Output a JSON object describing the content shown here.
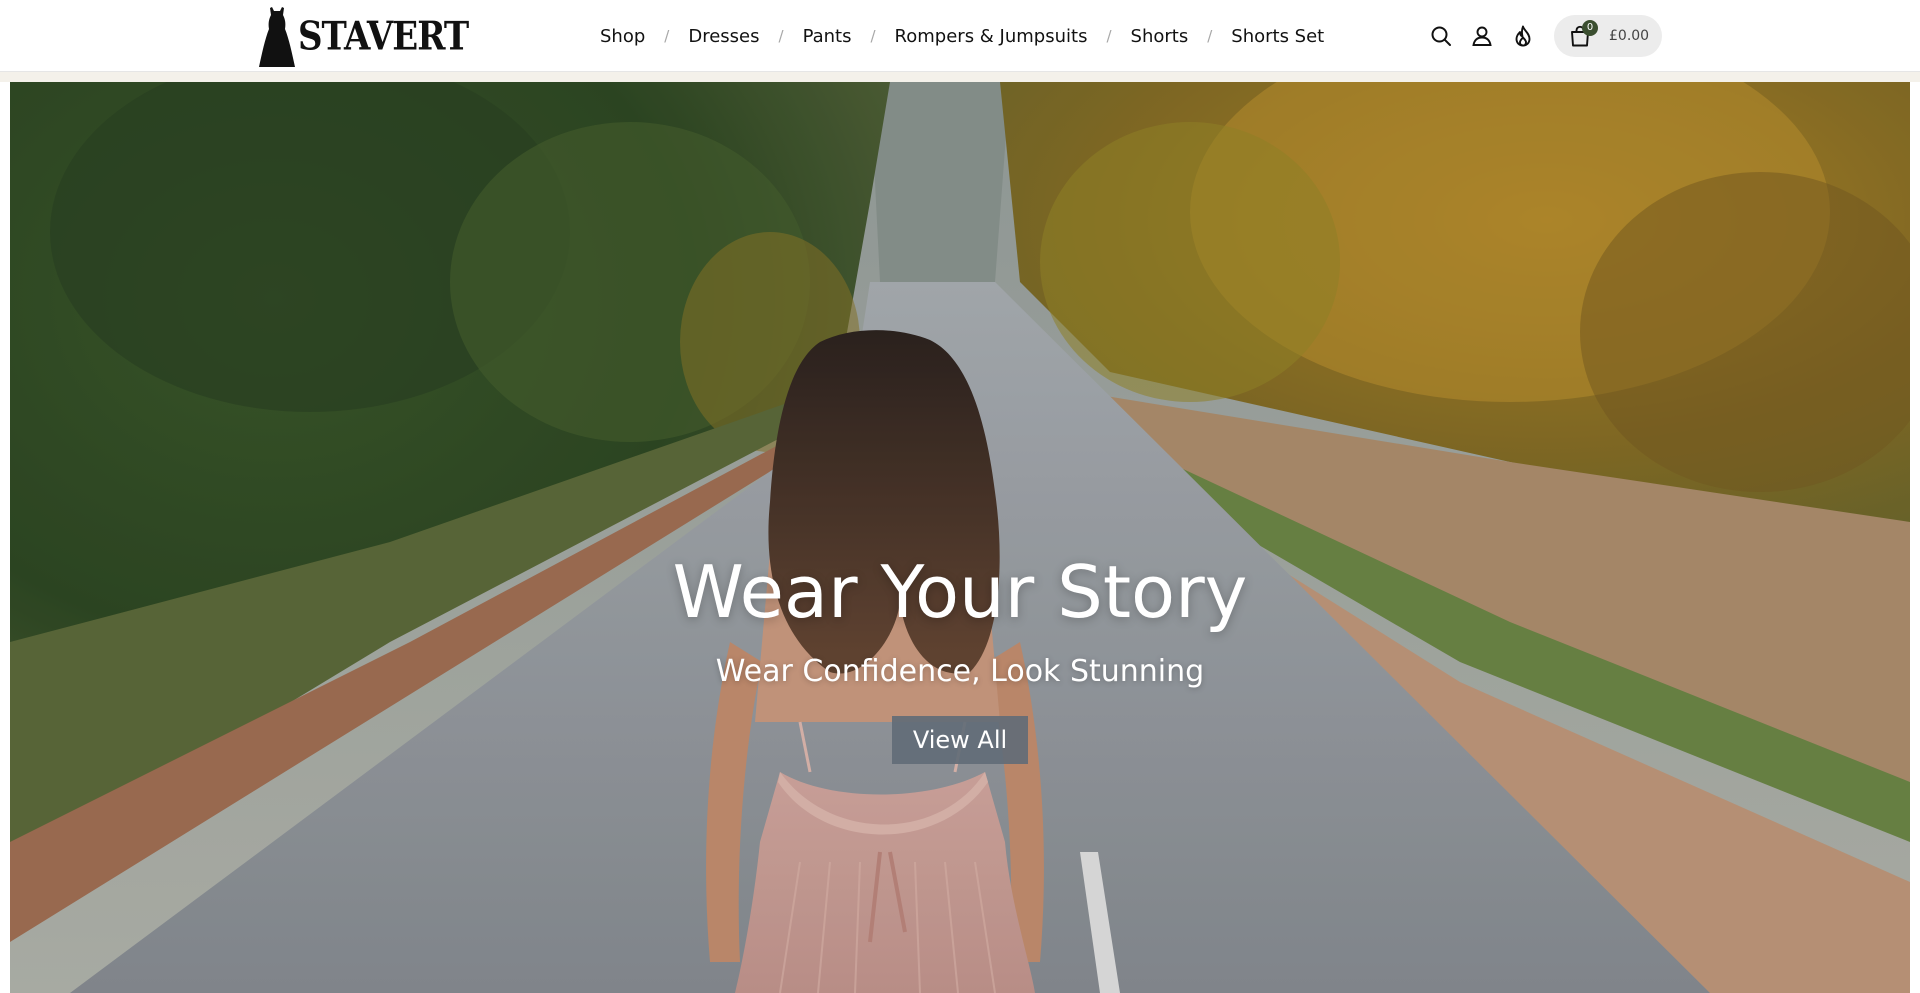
{
  "brand": {
    "name": "STAVERT"
  },
  "nav": {
    "items": [
      {
        "label": "Shop"
      },
      {
        "label": "Dresses"
      },
      {
        "label": "Pants"
      },
      {
        "label": "Rompers & Jumpsuits"
      },
      {
        "label": "Shorts"
      },
      {
        "label": "Shorts Set"
      }
    ],
    "separator": "/"
  },
  "header_icons": [
    "search-icon",
    "account-icon",
    "flame-icon",
    "shopping-bag-icon"
  ],
  "cart": {
    "count": "0",
    "total": "£0.00"
  },
  "hero": {
    "title": "Wear Your Story",
    "subtitle": "Wear Confidence, Look Stunning",
    "button_label": "View All"
  },
  "colors": {
    "header_bg": "#ffffff",
    "text": "#121212",
    "cart_pill": "#ececec",
    "cart_badge": "#3b4f30",
    "hero_button": "#626d77"
  }
}
